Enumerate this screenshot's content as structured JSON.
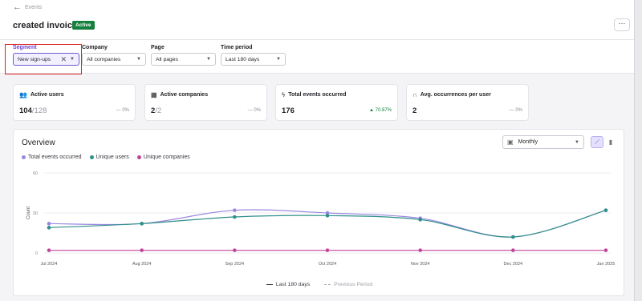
{
  "header": {
    "back_label": "Events",
    "title": "created invoice",
    "status": "Active",
    "more_label": "···"
  },
  "filters": {
    "segment": {
      "label": "Segment",
      "value": "New sign-ups"
    },
    "company": {
      "label": "Company",
      "value": "All companies"
    },
    "page": {
      "label": "Page",
      "value": "All pages"
    },
    "time_period": {
      "label": "Time period",
      "value": "Last 180 days"
    }
  },
  "metrics": [
    {
      "label": "Active users",
      "value": "104",
      "denominator": "/128",
      "change": "— 0%"
    },
    {
      "label": "Active companies",
      "value": "2",
      "denominator": "/2",
      "change": "— 0%"
    },
    {
      "label": "Total events occurred",
      "value": "176",
      "denominator": "",
      "change": "▲ 70.87%"
    },
    {
      "label": "Avg. occurrences per user",
      "value": "2",
      "denominator": "",
      "change": "— 0%"
    }
  ],
  "overview": {
    "title": "Overview",
    "granularity": "Monthly",
    "legend": [
      "Total events occurred",
      "Unique users",
      "Unique companies"
    ],
    "bottom_legend": {
      "current": "Last 180 days",
      "previous": "Previous Period"
    }
  },
  "colors": {
    "total_events": "#9b87e0",
    "unique_users": "#2f8f8a",
    "unique_companies": "#c2449a",
    "accent": "#6d5bd0",
    "active_badge": "#15803d",
    "highlight": "#e02424"
  },
  "icons": {
    "back": "arrow-left-icon",
    "users": "users-icon",
    "companies": "building-icon",
    "events": "bolt-icon",
    "avg": "bell-curve-icon",
    "calendar": "calendar-icon",
    "line_view": "line-chart-icon",
    "bar_view": "bar-chart-icon"
  },
  "chart_data": {
    "type": "line",
    "ylabel": "Count",
    "xlabel": "",
    "ylim": [
      0,
      60
    ],
    "yticks": [
      0,
      30,
      60
    ],
    "categories": [
      "Jul 2024",
      "Aug 2024",
      "Sep 2024",
      "Oct 2024",
      "Nov 2024",
      "Dec 2024",
      "Jan 2025"
    ],
    "grid": true,
    "series": [
      {
        "name": "Total events occurred",
        "values": [
          22,
          22,
          32,
          30,
          26,
          12,
          32
        ]
      },
      {
        "name": "Unique users",
        "values": [
          19,
          22,
          27,
          28,
          25,
          12,
          32
        ]
      },
      {
        "name": "Unique companies",
        "values": [
          2,
          2,
          2,
          2,
          2,
          2,
          2
        ]
      }
    ]
  }
}
